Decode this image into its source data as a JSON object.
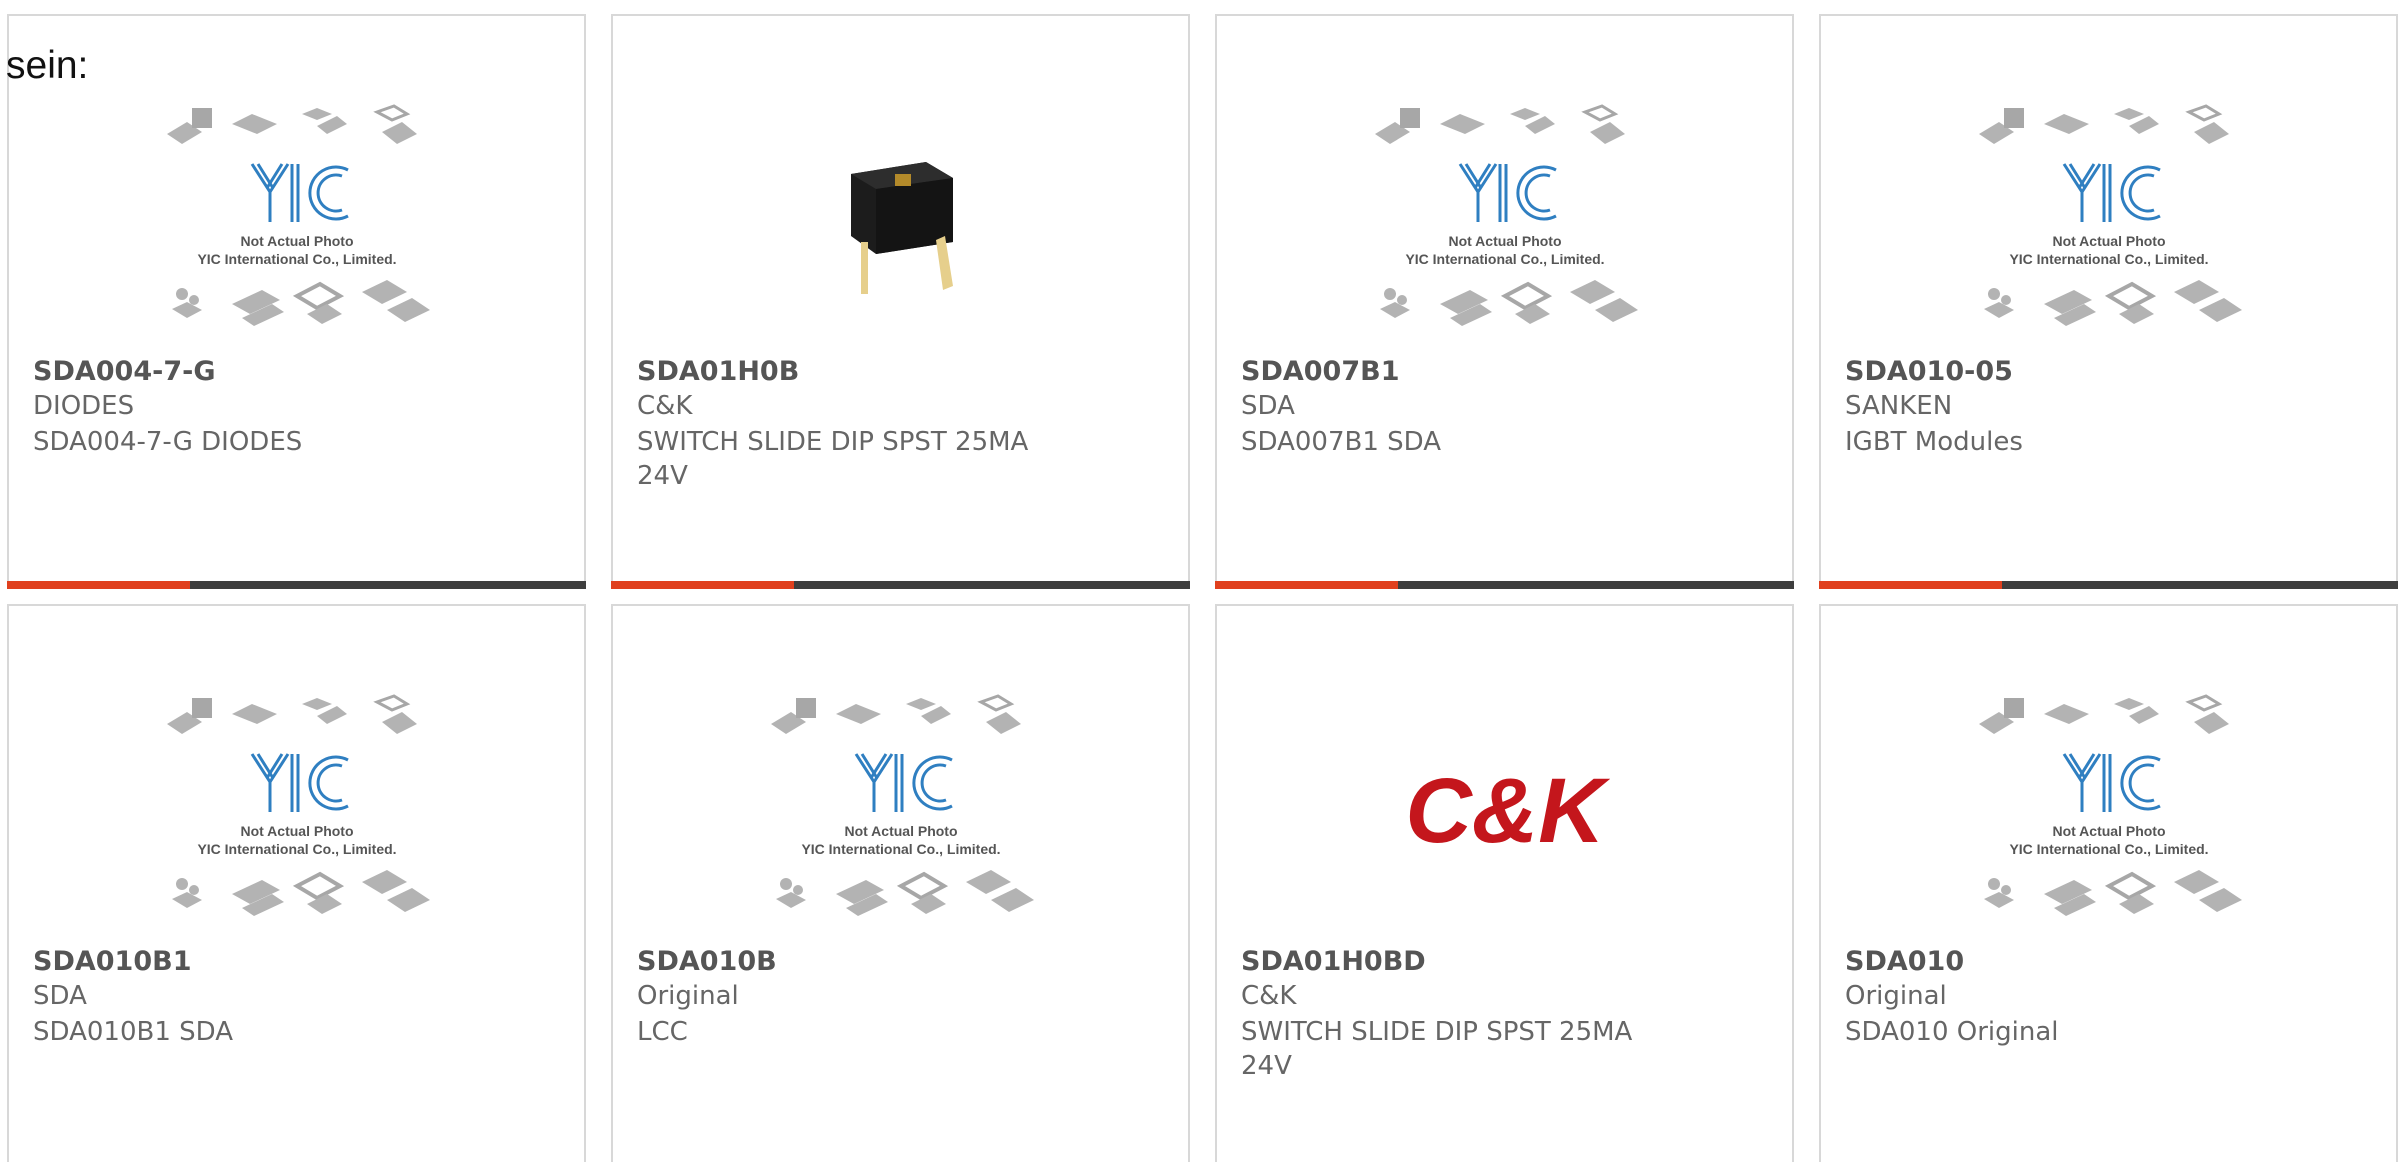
{
  "page": {
    "heading_fragment": "sein:"
  },
  "theme": {
    "accent": "#e0401e",
    "bar": "#3e3e3e",
    "placeholder_logo": "#2f7fc1",
    "ck_red": "#c4161c"
  },
  "placeholder": {
    "line1": "Not Actual Photo",
    "line2": "YIC International Co., Limited."
  },
  "ck_logo_text": "C&K",
  "products": [
    {
      "part_number": "SDA004-7-G",
      "manufacturer": "DIODES",
      "description": "SDA004-7-G DIODES",
      "image": "placeholder"
    },
    {
      "part_number": "SDA01H0B",
      "manufacturer": "C&K",
      "description": "SWITCH SLIDE DIP SPST 25MA 24V",
      "image": "dip-switch-photo"
    },
    {
      "part_number": "SDA007B1",
      "manufacturer": "SDA",
      "description": "SDA007B1 SDA",
      "image": "placeholder"
    },
    {
      "part_number": "SDA010-05",
      "manufacturer": "SANKEN",
      "description": "IGBT Modules",
      "image": "placeholder"
    },
    {
      "part_number": "SDA010B1",
      "manufacturer": "SDA",
      "description": "SDA010B1 SDA",
      "image": "placeholder"
    },
    {
      "part_number": "SDA010B",
      "manufacturer": "Original",
      "description": "LCC",
      "image": "placeholder"
    },
    {
      "part_number": "SDA01H0BD",
      "manufacturer": "C&K",
      "description": "SWITCH SLIDE DIP SPST 25MA 24V",
      "image": "ck-logo"
    },
    {
      "part_number": "SDA010",
      "manufacturer": "Original",
      "description": "SDA010 Original",
      "image": "placeholder"
    }
  ]
}
